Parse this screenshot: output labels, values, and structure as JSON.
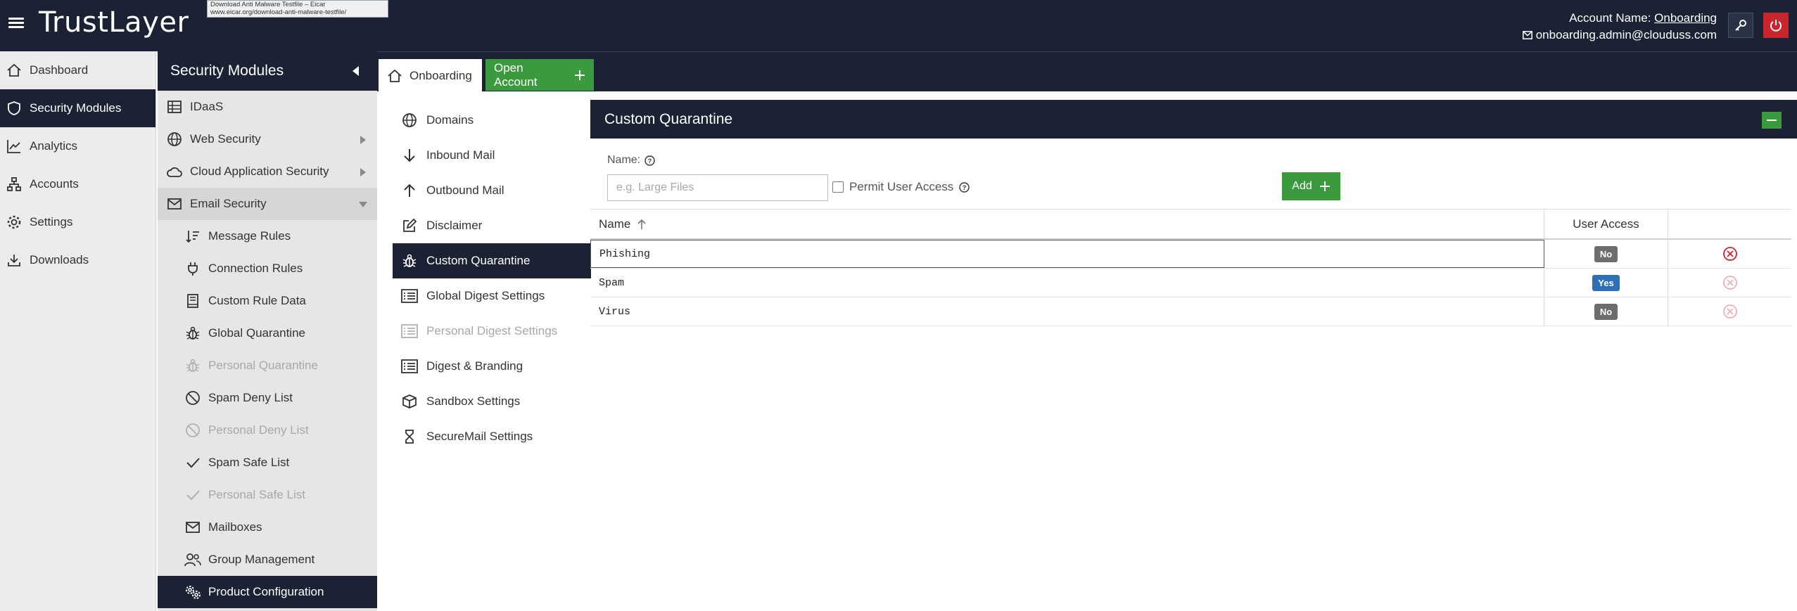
{
  "header": {
    "logo": "TrustLayer",
    "tooltip_line1": "Download Anti Malware Testfile – Eicar",
    "tooltip_line2": "www.eicar.org/download-anti-malware-testfile/",
    "account_label": "Account Name: ",
    "account_name": "Onboarding",
    "email": "onboarding.admin@clouduss.com"
  },
  "sidebar": {
    "items": [
      {
        "label": "Dashboard",
        "icon": "home-icon"
      },
      {
        "label": "Security Modules",
        "icon": "shield-icon"
      },
      {
        "label": "Analytics",
        "icon": "chart-icon"
      },
      {
        "label": "Accounts",
        "icon": "network-icon"
      },
      {
        "label": "Settings",
        "icon": "gear-icon"
      },
      {
        "label": "Downloads",
        "icon": "download-icon"
      }
    ]
  },
  "modules": {
    "title": "Security Modules",
    "items": [
      {
        "label": "IDaaS"
      },
      {
        "label": "Web Security"
      },
      {
        "label": "Cloud Application Security"
      },
      {
        "label": "Email Security"
      }
    ],
    "sub_items": [
      {
        "label": "Message Rules"
      },
      {
        "label": "Connection Rules"
      },
      {
        "label": "Custom Rule Data"
      },
      {
        "label": "Global Quarantine"
      },
      {
        "label": "Personal Quarantine"
      },
      {
        "label": "Spam Deny List"
      },
      {
        "label": "Personal Deny List"
      },
      {
        "label": "Spam Safe List"
      },
      {
        "label": "Personal Safe List"
      },
      {
        "label": "Mailboxes"
      },
      {
        "label": "Group Management"
      },
      {
        "label": "Product Configuration"
      }
    ]
  },
  "tabs": {
    "home": "Onboarding",
    "open_account": "Open Account"
  },
  "settings_nav": [
    {
      "label": "Domains"
    },
    {
      "label": "Inbound Mail"
    },
    {
      "label": "Outbound Mail"
    },
    {
      "label": "Disclaimer"
    },
    {
      "label": "Custom Quarantine"
    },
    {
      "label": "Global Digest Settings"
    },
    {
      "label": "Personal Digest Settings"
    },
    {
      "label": "Digest & Branding"
    },
    {
      "label": "Sandbox Settings"
    },
    {
      "label": "SecureMail Settings"
    }
  ],
  "panel": {
    "title": "Custom Quarantine",
    "name_label": "Name:",
    "name_placeholder": "e.g. Large Files",
    "permit_label": "Permit User Access",
    "add_label": "Add",
    "table": {
      "col_name": "Name",
      "col_access": "User Access",
      "rows": [
        {
          "name": "Phishing",
          "access": "No"
        },
        {
          "name": "Spam",
          "access": "Yes"
        },
        {
          "name": "Virus",
          "access": "No"
        }
      ]
    }
  },
  "colors": {
    "navy": "#1b2234",
    "green": "#3c9a3e",
    "red": "#c9252c",
    "blue": "#2f6fb7"
  }
}
